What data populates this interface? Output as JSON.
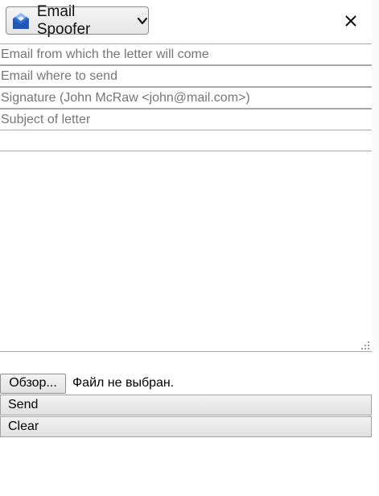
{
  "header": {
    "app_title": "Email Spoofer",
    "logo_icon": "envelope-logo-icon",
    "dropdown_icon": "chevron-down-icon",
    "close_icon": "close-icon"
  },
  "form": {
    "from_placeholder": "Email from which the letter will come",
    "to_placeholder": "Email where to send",
    "signature_placeholder": "Signature (John McRaw <john@mail.com>)",
    "subject_placeholder": "Subject of letter",
    "from_value": "",
    "to_value": "",
    "signature_value": "",
    "subject_value": "",
    "message_value": ""
  },
  "file": {
    "browse_label": "Обзор...",
    "status": "Файл не выбран."
  },
  "actions": {
    "send_label": "Send",
    "clear_label": "Clear"
  },
  "colors": {
    "logo_blue": "#2f6fd6",
    "logo_light": "#7fb0ff",
    "border": "#a9a9a9",
    "placeholder": "#767676"
  }
}
